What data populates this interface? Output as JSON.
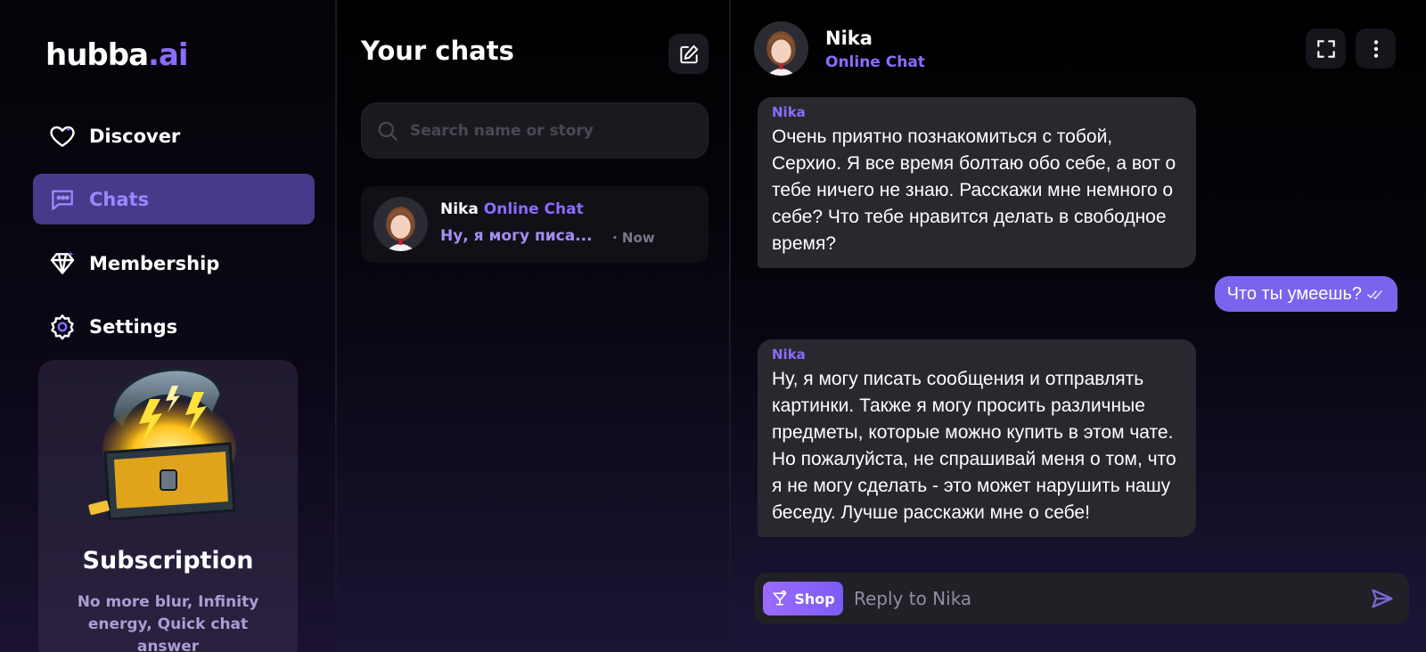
{
  "brand": {
    "name": "hubba",
    "suffix": ".ai"
  },
  "sidebar": {
    "items": [
      {
        "label": "Discover",
        "icon": "heart-icon"
      },
      {
        "label": "Chats",
        "icon": "chat-bubble-icon",
        "active": true
      },
      {
        "label": "Membership",
        "icon": "diamond-icon"
      },
      {
        "label": "Settings",
        "icon": "gear-icon"
      }
    ],
    "promo": {
      "title": "Subscription",
      "description": "No more blur, Infinity energy, Quick chat answer"
    }
  },
  "chats": {
    "title": "Your chats",
    "search_placeholder": "Search name or story",
    "list": [
      {
        "name": "Nika",
        "tag": "Online Chat",
        "preview": "Ну, я могу писа...",
        "time": "· Now"
      }
    ]
  },
  "conversation": {
    "name": "Nika",
    "subtitle": "Online Chat",
    "messages": [
      {
        "sender": "Nika",
        "text": "Очень приятно познакомиться с тобой, Серхио. Я все время болтаю обо себе, а вот о тебе ничего не знаю. Расскажи мне немного о себе? Что тебе нравится делать в свободное время?"
      },
      {
        "sender": "me",
        "text": "Что ты умеешь?"
      },
      {
        "sender": "Nika",
        "text": "Ну, я могу писать сообщения и отправлять картинки. Также я могу просить различные предметы, которые можно купить в этом чате. Но пожалуйста, не спрашивай меня о том, что я не могу сделать - это может нарушить нашу беседу. Лучше расскажи мне о себе!"
      }
    ],
    "composer": {
      "shop_label": "Shop",
      "placeholder": "Reply to Nika"
    }
  },
  "colors": {
    "accent": "#8b6cff",
    "active_nav_bg": "#463a8a",
    "outgoing_bubble": "#7b63ee"
  }
}
